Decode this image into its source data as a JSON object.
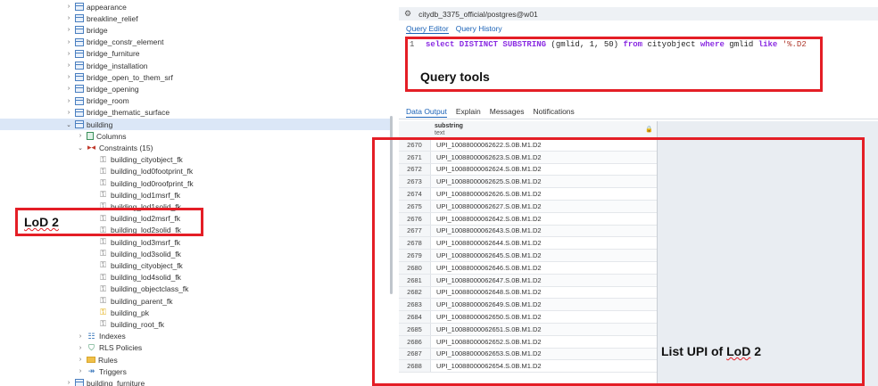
{
  "tree": {
    "items": [
      {
        "label": "appearance",
        "indent": 0,
        "chevron": ">",
        "icon": "table"
      },
      {
        "label": "breakline_relief",
        "indent": 0,
        "chevron": ">",
        "icon": "table"
      },
      {
        "label": "bridge",
        "indent": 0,
        "chevron": ">",
        "icon": "table"
      },
      {
        "label": "bridge_constr_element",
        "indent": 0,
        "chevron": ">",
        "icon": "table"
      },
      {
        "label": "bridge_furniture",
        "indent": 0,
        "chevron": ">",
        "icon": "table"
      },
      {
        "label": "bridge_installation",
        "indent": 0,
        "chevron": ">",
        "icon": "table"
      },
      {
        "label": "bridge_open_to_them_srf",
        "indent": 0,
        "chevron": ">",
        "icon": "table"
      },
      {
        "label": "bridge_opening",
        "indent": 0,
        "chevron": ">",
        "icon": "table"
      },
      {
        "label": "bridge_room",
        "indent": 0,
        "chevron": ">",
        "icon": "table"
      },
      {
        "label": "bridge_thematic_surface",
        "indent": 0,
        "chevron": ">",
        "icon": "table"
      },
      {
        "label": "building",
        "indent": 0,
        "chevron": "v",
        "icon": "table",
        "selected": true
      },
      {
        "label": "Columns",
        "indent": 1,
        "chevron": ">",
        "icon": "columns"
      },
      {
        "label": "Constraints (15)",
        "indent": 1,
        "chevron": "v",
        "icon": "constraint"
      },
      {
        "label": "building_cityobject_fk",
        "indent": 2,
        "chevron": "",
        "icon": "fk"
      },
      {
        "label": "building_lod0footprint_fk",
        "indent": 2,
        "chevron": "",
        "icon": "fk"
      },
      {
        "label": "building_lod0roofprint_fk",
        "indent": 2,
        "chevron": "",
        "icon": "fk"
      },
      {
        "label": "building_lod1msrf_fk",
        "indent": 2,
        "chevron": "",
        "icon": "fk"
      },
      {
        "label": "building_lod1solid_fk",
        "indent": 2,
        "chevron": "",
        "icon": "fk"
      },
      {
        "label": "building_lod2msrf_fk",
        "indent": 2,
        "chevron": "",
        "icon": "fk"
      },
      {
        "label": "building_lod2solid_fk",
        "indent": 2,
        "chevron": "",
        "icon": "fk"
      },
      {
        "label": "building_lod3msrf_fk",
        "indent": 2,
        "chevron": "",
        "icon": "fk"
      },
      {
        "label": "building_lod3solid_fk",
        "indent": 2,
        "chevron": "",
        "icon": "fk"
      },
      {
        "label": "building_cityobject_fk",
        "indent": 2,
        "chevron": "",
        "icon": "fk"
      },
      {
        "label": "building_lod4solid_fk",
        "indent": 2,
        "chevron": "",
        "icon": "fk"
      },
      {
        "label": "building_objectclass_fk",
        "indent": 2,
        "chevron": "",
        "icon": "fk"
      },
      {
        "label": "building_parent_fk",
        "indent": 2,
        "chevron": "",
        "icon": "fk"
      },
      {
        "label": "building_pk",
        "indent": 2,
        "chevron": "",
        "icon": "pk"
      },
      {
        "label": "building_root_fk",
        "indent": 2,
        "chevron": "",
        "icon": "fk"
      },
      {
        "label": "Indexes",
        "indent": 1,
        "chevron": ">",
        "icon": "index"
      },
      {
        "label": "RLS Policies",
        "indent": 1,
        "chevron": ">",
        "icon": "rls"
      },
      {
        "label": "Rules",
        "indent": 1,
        "chevron": ">",
        "icon": "rules"
      },
      {
        "label": "Triggers",
        "indent": 1,
        "chevron": ">",
        "icon": "trigger"
      },
      {
        "label": "building_furniture",
        "indent": 0,
        "chevron": ">",
        "icon": "table"
      }
    ]
  },
  "query_tool": {
    "title": "citydb_3375_official/postgres@w01",
    "tabs": [
      "Query Editor",
      "Query History"
    ],
    "editor": {
      "line_number": "1",
      "sql": {
        "kw1": "select DISTINCT SUBSTRING",
        "t1": " (gmlid, 1, 50) ",
        "kw2": "from",
        "t2": " cityobject ",
        "kw3": "where",
        "t3": " gmlid ",
        "kw4": "like",
        "s1": " '%.D2"
      }
    },
    "output_tabs": [
      "Data Output",
      "Explain",
      "Messages",
      "Notifications"
    ],
    "grid": {
      "column_name": "substring",
      "column_type": "text",
      "lock_icon": "lock-icon",
      "rows": [
        {
          "n": "2670",
          "v": "UPI_10088000062622.S.0B.M1.D2"
        },
        {
          "n": "2671",
          "v": "UPI_10088000062623.S.0B.M1.D2"
        },
        {
          "n": "2672",
          "v": "UPI_10088000062624.S.0B.M1.D2"
        },
        {
          "n": "2673",
          "v": "UPI_10088000062625.S.0B.M1.D2"
        },
        {
          "n": "2674",
          "v": "UPI_10088000062626.S.0B.M1.D2"
        },
        {
          "n": "2675",
          "v": "UPI_10088000062627.S.0B.M1.D2"
        },
        {
          "n": "2676",
          "v": "UPI_10088000062642.S.0B.M1.D2"
        },
        {
          "n": "2677",
          "v": "UPI_10088000062643.S.0B.M1.D2"
        },
        {
          "n": "2678",
          "v": "UPI_10088000062644.S.0B.M1.D2"
        },
        {
          "n": "2679",
          "v": "UPI_10088000062645.S.0B.M1.D2"
        },
        {
          "n": "2680",
          "v": "UPI_10088000062646.S.0B.M1.D2"
        },
        {
          "n": "2681",
          "v": "UPI_10088000062647.S.0B.M1.D2"
        },
        {
          "n": "2682",
          "v": "UPI_10088000062648.S.0B.M1.D2"
        },
        {
          "n": "2683",
          "v": "UPI_10088000062649.S.0B.M1.D2"
        },
        {
          "n": "2684",
          "v": "UPI_10088000062650.S.0B.M1.D2"
        },
        {
          "n": "2685",
          "v": "UPI_10088000062651.S.0B.M1.D2"
        },
        {
          "n": "2686",
          "v": "UPI_10088000062652.S.0B.M1.D2"
        },
        {
          "n": "2687",
          "v": "UPI_10088000062653.S.0B.M1.D2"
        },
        {
          "n": "2688",
          "v": "UPI_10088000062654.S.0B.M1.D2"
        }
      ]
    }
  },
  "annotations": {
    "query_tools": "Query tools",
    "lod2": "LoD 2",
    "list_upi": "List UPI of ",
    "list_upi_lod": "LoD",
    "list_upi_tail": " 2",
    "color": "#e41e26"
  }
}
